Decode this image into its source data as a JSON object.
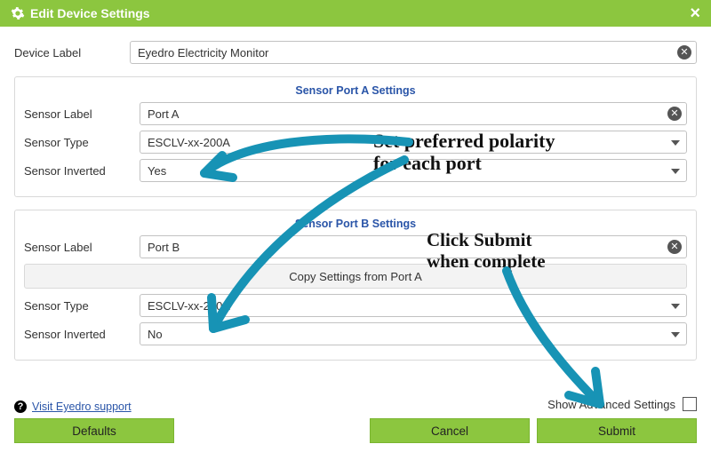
{
  "dialog": {
    "title": "Edit Device Settings",
    "close_label": "×"
  },
  "device": {
    "label_text": "Device Label",
    "value": "Eyedro Electricity Monitor"
  },
  "port_a": {
    "heading": "Sensor Port A Settings",
    "sensor_label_text": "Sensor Label",
    "sensor_label_value": "Port A",
    "sensor_type_text": "Sensor Type",
    "sensor_type_value": "ESCLV-xx-200A",
    "sensor_inverted_text": "Sensor Inverted",
    "sensor_inverted_value": "Yes"
  },
  "port_b": {
    "heading": "Sensor Port B Settings",
    "sensor_label_text": "Sensor Label",
    "sensor_label_value": "Port B",
    "copy_text": "Copy Settings from Port A",
    "sensor_type_text": "Sensor Type",
    "sensor_type_value": "ESCLV-xx-200A",
    "sensor_inverted_text": "Sensor Inverted",
    "sensor_inverted_value": "No"
  },
  "footer": {
    "support_link": "Visit Eyedro support",
    "advanced_label": "Show Advanced Settings",
    "defaults_btn": "Defaults",
    "cancel_btn": "Cancel",
    "submit_btn": "Submit"
  },
  "annotations": {
    "polarity": "Set preferred polarity\nfor each port",
    "submit": "Click Submit\nwhen complete"
  }
}
